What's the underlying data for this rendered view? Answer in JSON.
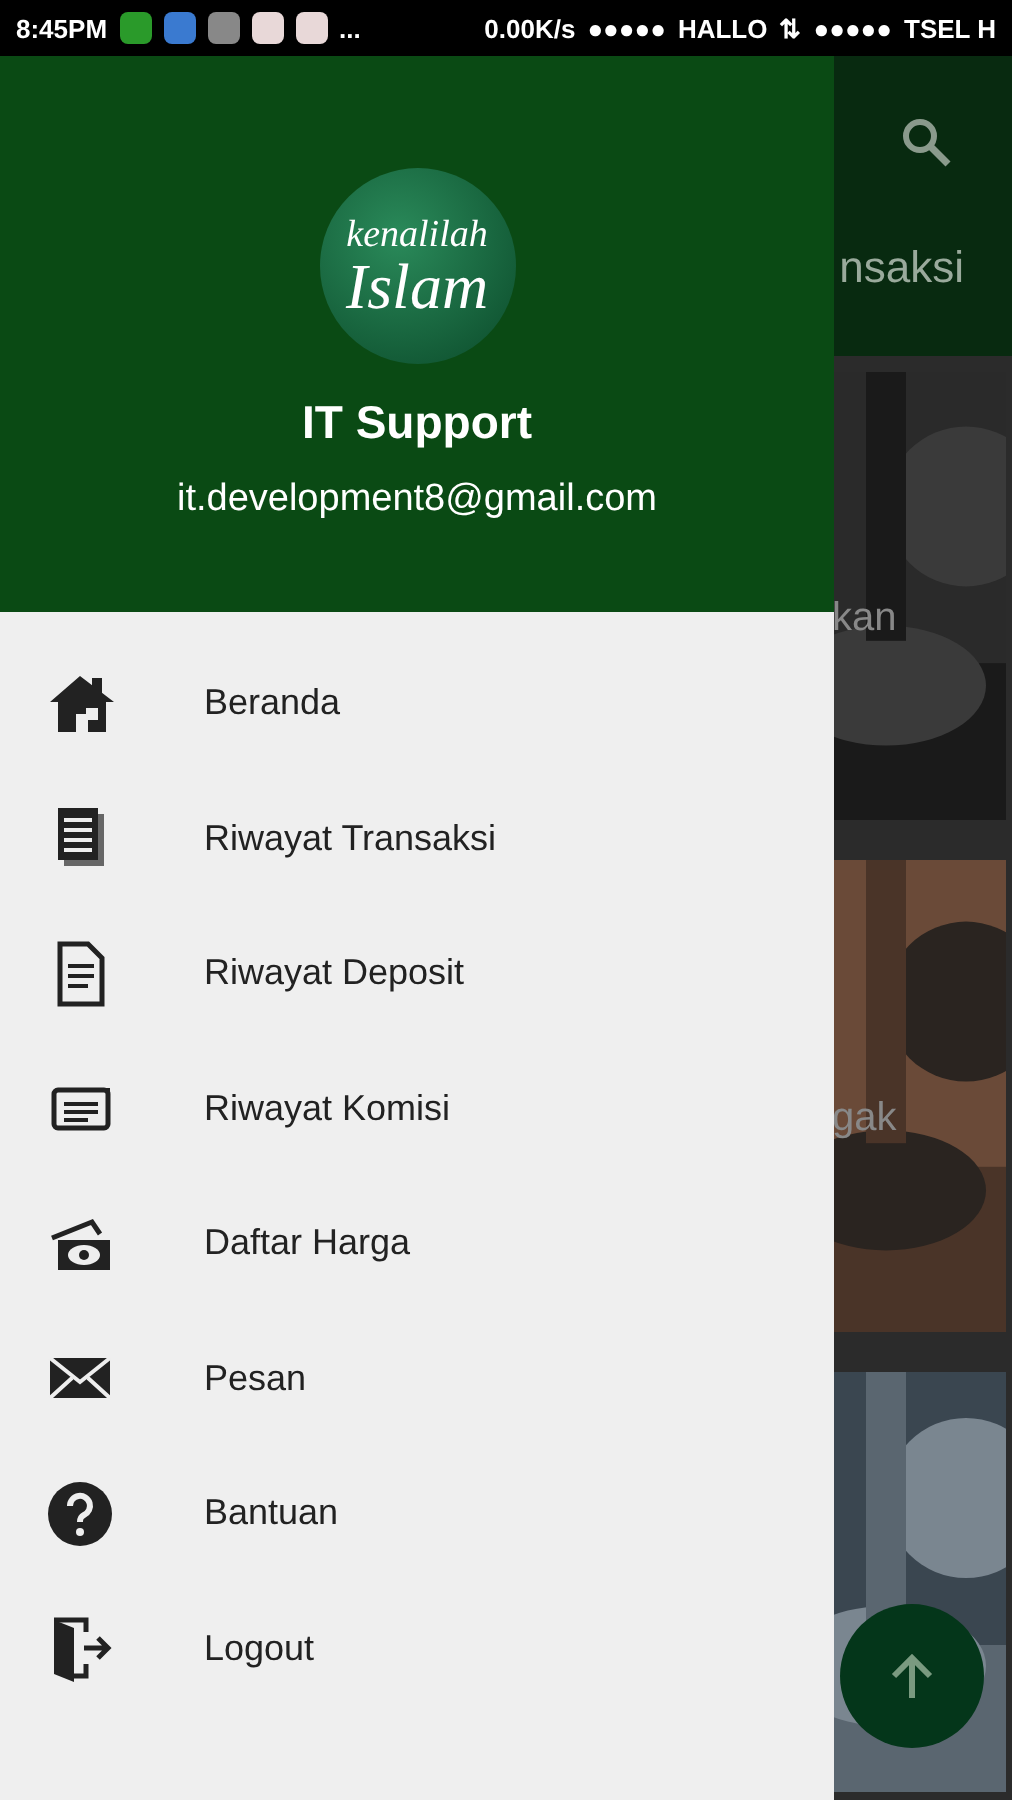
{
  "status_bar": {
    "time": "8:45PM",
    "more": "...",
    "speed": "0.00K/s",
    "signal_1": "●●●●●",
    "carrier_1": "HALLO",
    "data_arrows": "⇅",
    "signal_2": "●●●●●",
    "carrier_2": "TSEL H"
  },
  "app_bar": {
    "tab_label": "nsaksi"
  },
  "cards": [
    {
      "caption": "kan",
      "kind": "picture"
    },
    {
      "caption": "gak",
      "kind": "picture"
    },
    {
      "kind": "picture"
    }
  ],
  "drawer": {
    "logo_line_1": "kenalilah",
    "logo_line_2": "Islam",
    "user_name": "IT Support",
    "email": "it.development8@gmail.com",
    "items": [
      {
        "label": "Beranda"
      },
      {
        "label": "Riwayat Transaksi"
      },
      {
        "label": "Riwayat Deposit"
      },
      {
        "label": "Riwayat Komisi"
      },
      {
        "label": "Daftar Harga"
      },
      {
        "label": "Pesan"
      },
      {
        "label": "Bantuan"
      },
      {
        "label": "Logout"
      }
    ]
  }
}
